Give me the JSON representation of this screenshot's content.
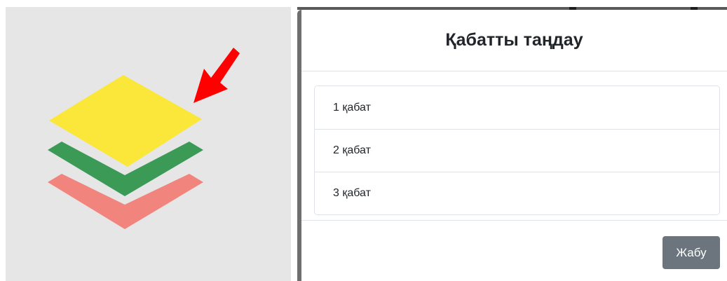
{
  "modal": {
    "title": "Қабатты таңдау",
    "options": [
      {
        "label": "1 қабат"
      },
      {
        "label": "2 қабат"
      },
      {
        "label": "3 қабат"
      }
    ],
    "close_label": "Жабу"
  },
  "icon": {
    "name": "layers-icon",
    "colors": {
      "top_layer": "#fbe739",
      "middle_layer": "#3a9a56",
      "bottom_layer": "#f2847e",
      "arrow": "#ff0000",
      "panel_background": "#e6e6e6"
    }
  },
  "colors": {
    "close_button": "#6c757d",
    "border": "#dee2e6",
    "text": "#212529"
  }
}
